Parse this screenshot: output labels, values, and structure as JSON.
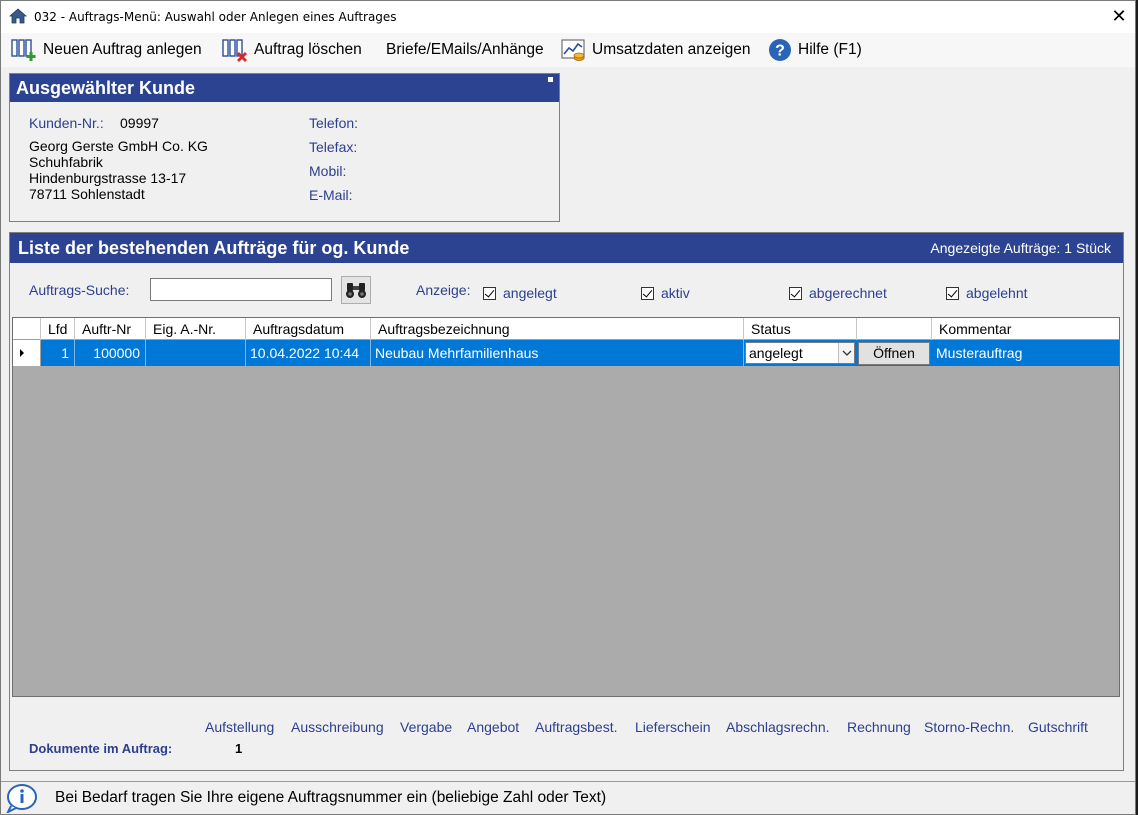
{
  "window": {
    "title": "032  -  Auftrags-Menü: Auswahl oder Anlegen eines Auftrages",
    "close_glyph": "✕"
  },
  "toolbar": {
    "new_order": "Neuen Auftrag anlegen",
    "delete_order": "Auftrag löschen",
    "letters": "Briefe/EMails/Anhänge",
    "sales": "Umsatzdaten anzeigen",
    "help": "Hilfe (F1)"
  },
  "customer": {
    "heading": "Ausgewählter Kunde",
    "number_label": "Kunden-Nr.:",
    "number": "09997",
    "name": "Georg Gerste GmbH  Co. KG",
    "line2": "Schuhfabrik",
    "street": "Hindenburgstrasse 13-17",
    "city": "78711 Sohlenstadt",
    "phone_label": "Telefon:",
    "fax_label": "Telefax:",
    "mobile_label": "Mobil:",
    "email_label": "E-Mail:"
  },
  "orders": {
    "heading": "Liste der bestehenden Aufträge für og. Kunde",
    "count_text": "Angezeigte Aufträge: 1 Stück",
    "search_label": "Auftrags-Suche:",
    "search_value": "",
    "display_label": "Anzeige:",
    "filters": [
      {
        "label": "angelegt",
        "checked": true
      },
      {
        "label": "aktiv",
        "checked": true
      },
      {
        "label": "abgerechnet",
        "checked": true
      },
      {
        "label": "abgelehnt",
        "checked": true
      }
    ],
    "columns": [
      "Lfd",
      "Auftr-Nr",
      "Eig. A.-Nr.",
      "Auftragsdatum",
      "Auftragsbezeichnung",
      "Status",
      "",
      "Kommentar"
    ],
    "rows": [
      {
        "lfd": "1",
        "nr": "100000",
        "eig": "",
        "date": "10.04.2022 10:44",
        "desc": "Neubau Mehrfamilienhaus",
        "status": "angelegt",
        "open": "Öffnen",
        "comment": "Musterauftrag"
      }
    ]
  },
  "documents": {
    "links": [
      "Aufstellung",
      "Ausschreibung",
      "Vergabe",
      "Angebot",
      "Auftragsbest.",
      "Lieferschein",
      "Abschlagsrechn.",
      "Rechnung",
      "Storno-Rechn.",
      "Gutschrift"
    ],
    "count_label": "Dokumente im Auftrag:",
    "count": "1"
  },
  "statusbar": {
    "hint": "Bei Bedarf tragen Sie Ihre eigene Auftragsnummer ein (beliebige Zahl oder Text)"
  },
  "colors": {
    "header_blue": "#2c4391",
    "label_blue": "#2c3f8e",
    "selection_blue": "#0078d7",
    "grid_gray": "#ababab"
  }
}
